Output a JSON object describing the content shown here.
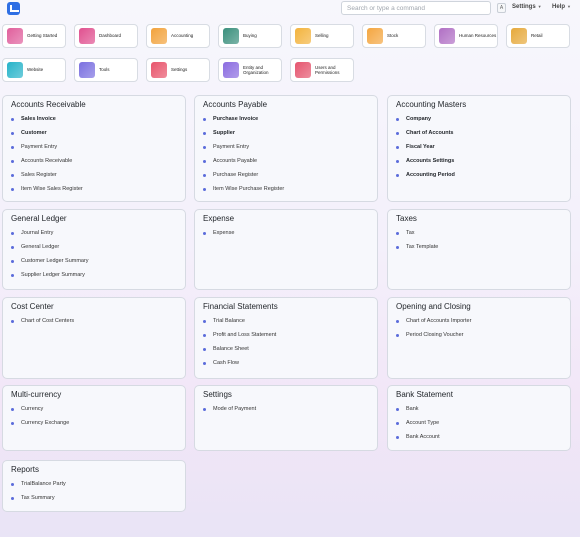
{
  "topbar": {
    "search_placeholder": "Search or type a command",
    "avatar": "A",
    "settings_label": "Settings",
    "help_label": "Help"
  },
  "shortcuts": [
    {
      "label": "Getting Started",
      "icon": "key-icon",
      "color": "#e05f9c"
    },
    {
      "label": "Dashboard",
      "icon": "dashboard-icon",
      "color": "#e0508f"
    },
    {
      "label": "Accounting",
      "icon": "accounting-icon",
      "color": "#f2a23b"
    },
    {
      "label": "Buying",
      "icon": "buying-icon",
      "color": "#3a8f7c"
    },
    {
      "label": "Selling",
      "icon": "selling-icon",
      "color": "#f3b33d"
    },
    {
      "label": "Stock",
      "icon": "stock-icon",
      "color": "#f4a640"
    },
    {
      "label": "Human Resources",
      "icon": "hr-icon",
      "color": "#b06fc4"
    },
    {
      "label": "Retail",
      "icon": "retail-icon",
      "color": "#e6a93b"
    },
    {
      "label": "Website",
      "icon": "website-icon",
      "color": "#26b3c9"
    },
    {
      "label": "Tools",
      "icon": "tools-icon",
      "color": "#7a6fe0"
    },
    {
      "label": "Settings",
      "icon": "settings-icon",
      "color": "#e8546b"
    },
    {
      "label": "Entity and Organization",
      "icon": "entity-icon",
      "color": "#8a6be0"
    },
    {
      "label": "Users and Permissions",
      "icon": "users-icon",
      "color": "#e5556e"
    }
  ],
  "cards": [
    {
      "title": "Accounts Receivable",
      "items": [
        {
          "label": "Sales Invoice",
          "bold": true
        },
        {
          "label": "Customer",
          "bold": true
        },
        {
          "label": "Payment Entry",
          "bold": false
        },
        {
          "label": "Accounts Receivable",
          "bold": false
        },
        {
          "label": "Sales Register",
          "bold": false
        },
        {
          "label": "Item Wise Sales Register",
          "bold": false
        }
      ]
    },
    {
      "title": "Accounts Payable",
      "items": [
        {
          "label": "Purchase Invoice",
          "bold": true
        },
        {
          "label": "Supplier",
          "bold": true
        },
        {
          "label": "Payment Entry",
          "bold": false
        },
        {
          "label": "Accounts Payable",
          "bold": false
        },
        {
          "label": "Purchase Register",
          "bold": false
        },
        {
          "label": "Item Wise Purchase Register",
          "bold": false
        }
      ]
    },
    {
      "title": "Accounting Masters",
      "items": [
        {
          "label": "Company",
          "bold": true
        },
        {
          "label": "Chart of Accounts",
          "bold": true
        },
        {
          "label": "Fiscal Year",
          "bold": true
        },
        {
          "label": "Accounts Settings",
          "bold": true
        },
        {
          "label": "Accounting Period",
          "bold": true
        }
      ]
    },
    {
      "title": "General Ledger",
      "items": [
        {
          "label": "Journal Entry",
          "bold": false
        },
        {
          "label": "General Ledger",
          "bold": false
        },
        {
          "label": "Customer Ledger Summary",
          "bold": false
        },
        {
          "label": "Supplier Ledger Summary",
          "bold": false
        }
      ]
    },
    {
      "title": "Expense",
      "items": [
        {
          "label": "Expense",
          "bold": false
        }
      ]
    },
    {
      "title": "Taxes",
      "items": [
        {
          "label": "Tax",
          "bold": false
        },
        {
          "label": "Tax Template",
          "bold": false
        }
      ]
    },
    {
      "title": "Cost Center",
      "items": [
        {
          "label": "Chart of Cost Centers",
          "bold": false
        }
      ]
    },
    {
      "title": "Financial Statements",
      "items": [
        {
          "label": "Trial Balance",
          "bold": false
        },
        {
          "label": "Profit and Loss Statement",
          "bold": false
        },
        {
          "label": "Balance Sheet",
          "bold": false
        },
        {
          "label": "Cash Flow",
          "bold": false
        }
      ]
    },
    {
      "title": "Opening and Closing",
      "items": [
        {
          "label": "Chart of Accounts Importer",
          "bold": false
        },
        {
          "label": "Period Closing Voucher",
          "bold": false
        }
      ]
    },
    {
      "title": "Multi-currency",
      "items": [
        {
          "label": "Currency",
          "bold": false
        },
        {
          "label": "Currency Exchange",
          "bold": false
        }
      ]
    },
    {
      "title": "Settings",
      "items": [
        {
          "label": "Mode of Payment",
          "bold": false
        }
      ]
    },
    {
      "title": "Bank Statement",
      "items": [
        {
          "label": "Bank",
          "bold": false
        },
        {
          "label": "Account Type",
          "bold": false
        },
        {
          "label": "Bank Account",
          "bold": false
        }
      ]
    },
    {
      "title": "Reports",
      "items": [
        {
          "label": "TrialBalance Party",
          "bold": false
        },
        {
          "label": "Tax Summary",
          "bold": false
        }
      ]
    }
  ]
}
